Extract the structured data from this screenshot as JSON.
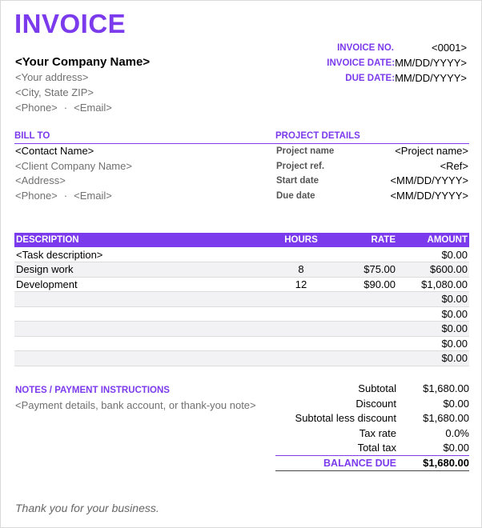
{
  "title": "INVOICE",
  "meta": {
    "invoice_no_label": "INVOICE NO.",
    "invoice_no": "<0001>",
    "invoice_date_label": "INVOICE DATE:",
    "invoice_date": "MM/DD/YYYY>",
    "due_date_label": "DUE DATE:",
    "due_date": "MM/DD/YYYY>"
  },
  "company": {
    "name": "<Your Company Name>",
    "address": "<Your address>",
    "city": "<City, State ZIP>",
    "phone": "<Phone>",
    "separator": "·",
    "email": "<Email>"
  },
  "bill_to": {
    "header": "BILL TO",
    "contact": "<Contact Name>",
    "client_company": "<Client Company Name>",
    "address": "<Address>",
    "phone": "<Phone>",
    "separator": "·",
    "email": "<Email>"
  },
  "project": {
    "header": "PROJECT DETAILS",
    "rows": [
      {
        "label": "Project name",
        "value": "<Project name>"
      },
      {
        "label": "Project ref.",
        "value": "<Ref>"
      },
      {
        "label": "Start date",
        "value": "<MM/DD/YYYY>"
      },
      {
        "label": "Due date",
        "value": "<MM/DD/YYYY>"
      }
    ]
  },
  "items": {
    "headers": {
      "description": "DESCRIPTION",
      "hours": "HOURS",
      "rate": "RATE",
      "amount": "AMOUNT"
    },
    "rows": [
      {
        "description": "<Task description>",
        "hours": "",
        "rate": "",
        "amount": "$0.00"
      },
      {
        "description": "Design work",
        "hours": "8",
        "rate": "$75.00",
        "amount": "$600.00"
      },
      {
        "description": "Development",
        "hours": "12",
        "rate": "$90.00",
        "amount": "$1,080.00"
      },
      {
        "description": "",
        "hours": "",
        "rate": "",
        "amount": "$0.00"
      },
      {
        "description": "",
        "hours": "",
        "rate": "",
        "amount": "$0.00"
      },
      {
        "description": "",
        "hours": "",
        "rate": "",
        "amount": "$0.00"
      },
      {
        "description": "",
        "hours": "",
        "rate": "",
        "amount": "$0.00"
      },
      {
        "description": "",
        "hours": "",
        "rate": "",
        "amount": "$0.00"
      }
    ]
  },
  "notes": {
    "header": "NOTES / PAYMENT INSTRUCTIONS",
    "text": "<Payment details, bank account, or thank-you note>"
  },
  "totals": {
    "subtotal_label": "Subtotal",
    "subtotal": "$1,680.00",
    "discount_label": "Discount",
    "discount": "$0.00",
    "less_discount_label": "Subtotal less discount",
    "less_discount": "$1,680.00",
    "tax_rate_label": "Tax rate",
    "tax_rate": "0.0%",
    "total_tax_label": "Total tax",
    "total_tax": "$0.00",
    "balance_label": "BALANCE DUE",
    "balance": "$1,680.00"
  },
  "footer": {
    "thanks": "Thank you for your business."
  },
  "colors": {
    "accent": "#7c3aed",
    "muted_text": "#707070",
    "row_stripe": "#f2f2f5"
  }
}
